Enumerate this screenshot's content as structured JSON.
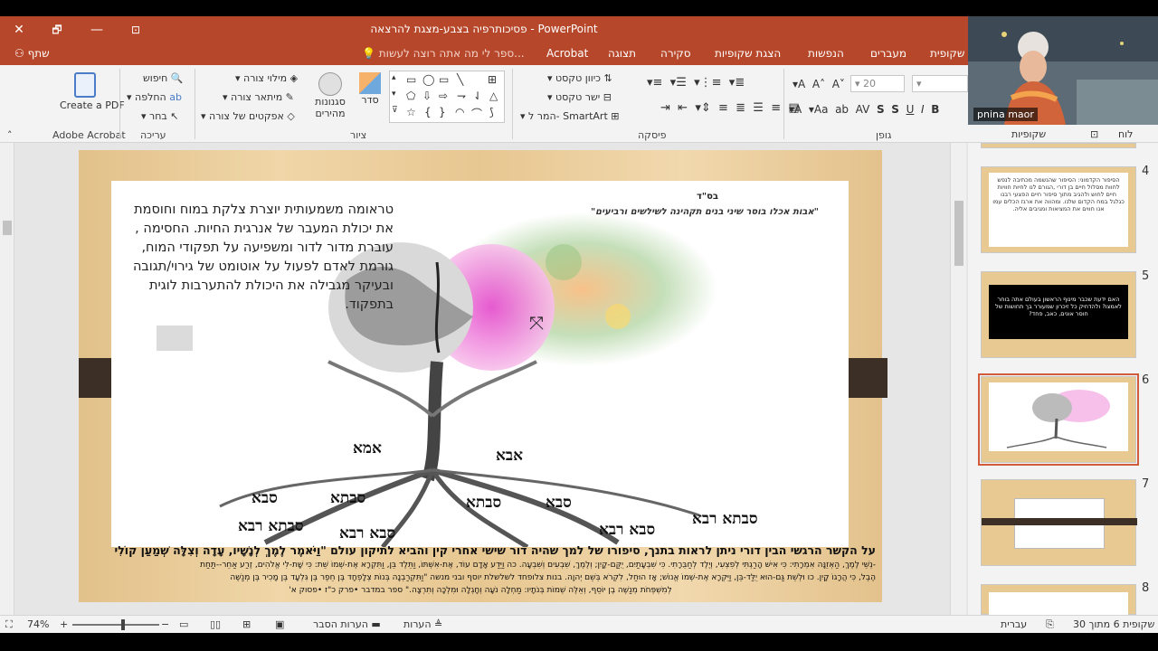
{
  "window": {
    "title": "פסיכותרפיה בצבע-מצגת להרצאה - PowerPoint",
    "close": "✕",
    "restore": "🗗",
    "minimize": "—",
    "ribbon_display": "⊡"
  },
  "tabs": {
    "items": [
      "שקופית",
      "מעברים",
      "הנפשות",
      "הצגת שקופיות",
      "סקירה",
      "תצוגה",
      "Acrobat"
    ],
    "tell_me": "ספר לי מה אתה רוצה לעשות...",
    "share": "שתף"
  },
  "ribbon": {
    "acrobat": {
      "create_pdf": "Create a PDF",
      "group": "Adobe Acrobat"
    },
    "editing": {
      "find": "חיפוש",
      "replace": "החלפה",
      "select": "בחר",
      "group": "עריכה"
    },
    "drawing": {
      "shape_fill": "מילוי צורה",
      "shape_outline": "מיתאר צורה",
      "shape_effects": "אפקטים של צורה",
      "quick_styles": "סגנונות מהירים",
      "arrange": "סדר",
      "group": "ציור",
      "shapes": [
        "▭",
        "◯",
        "▭",
        "╲",
        "⊞",
        "⬠",
        "⇩",
        "⇨",
        "⇁",
        "⇃",
        "△",
        "☆",
        "{",
        "}",
        "◠",
        "⌒",
        "⟆"
      ]
    },
    "paragraph": {
      "text_direction": "כיוון טקסט",
      "align_text": "ישר טקסט",
      "smartart": "המר ל- SmartArt",
      "group": "פיסקה"
    },
    "font": {
      "size": "20",
      "group": "גופן",
      "bold": "B",
      "italic": "I",
      "underline": "U",
      "strike": "S"
    },
    "slides_group": "לוח"
  },
  "panes": {
    "thumbnails_label": "שקופיות",
    "clipboard_label": "לוח"
  },
  "slide": {
    "bsd": "בס\"ד",
    "subtitle": "\"אבות אכלו בוסר שיני בנים תקהינה לשילשים ורביעים\"",
    "trauma_text": "טראומה משמעותית יוצרת צלקת  במוח וחוסמת את יכולת המעבר של אנרגית החיות. החסימה , עוברת מדור לדור ומשפיעה על תפקודי המוח, גורמת לאדם לפעול על אוטומט של גירוי/תגובה ובעיקר מגבילה את היכולת להתערבות לוגית בתפקוד.",
    "family": {
      "ima": "אמא",
      "aba": "אבא",
      "saba1": "סבא",
      "savta1": "סבתא",
      "savta2": "סבתא",
      "saba2": "סבא",
      "savta_raba1": "סבתא רבא",
      "saba_raba1": "סבא רבא",
      "saba_raba2": "סבא רבא",
      "savta_raba2": "סבתא רבא"
    },
    "bottom": {
      "line1": "על הקשר הרגשי הבין דורי ניתן לראות בתנך,  סיפורו של למך שהיה דור שישי אחרי קין  והביא לתיקון עולם \"וַיֹּאמֶר לֶמֶךְ לְנָשָׁיו, עָדָה וְצִלָּה שְׁמַעַן קוֹלִי",
      "line2": "-נְשֵׁי לֶמֶךְ, הַאְזֵנָּה אִמְרָתִי:  כִּי אִישׁ הָרַגְתִּי לְפִצְעִי, וְיֶלֶד לְחַבֻּרָתִי. כִּי שִׁבְעָתַיִם, יֻקַּם-קָיִן; וְלֶמֶךְ, שִׁבְעִים וְשִׁבְעָה. כה וַיֵּדַע אָדָם עוֹד, אֶת-אִשְׁתּוֹ, וַתֵּלֶד בֵּן, וַתִּקְרָא אֶת-שְׁמוֹ שֵׁת:  כִּי שָׁת-לִי אֱלֹהִים, זֶרַע אַחֵר--תַּחַת",
      "line3": "הֶבֶל, כִּי הֲרָגוֹ קָיִן.  כו וּלְשֵׁת גַּם-הוּא יֻלַּד-בֵּן, וַיִּקְרָא אֶת-שְׁמוֹ אֱנוֹשׁ; אָז הוּחַל, לִקְרֹא בְּשֵׁם יְהוָה.  בנות צלופחד  לשלשלת יוסף ובני מנשה \"וַתִּקְרַבְנָה בְּנוֹת צְלָפְחָד בֶּן חֵפֶר בֶּן גִּלְעָד בֶּן מָכִיר בֶּן מְנַשֶּׁה",
      "line4": "לְמִשְׁפְּחֹת מְנַשֶּׁה בֶן יוֹסֵף, וְאֵלֶּה שְׁמוֹת בְּנֹתָיו:  מַחְלָה נֹעָה וְחָגְלָה וּמִלְכָּה וְתִרְצָה.\" ספר במדבר  •פרק כ\"ז  •פסוק א'"
    }
  },
  "thumbnails": [
    {
      "num": "4",
      "text": "הסיפור הקדמוני: הסיפור שהנשמה מכתיבה לנפש לחוות מסלול חיים בן דורי ,הגורם לנו לחיות חוויות חיים לחוש ולהגיב מתוך סיפור חיים הפצעי רבנו כגלגל במח הקדום שלנו. ומהווה את ארגז הכלים עמו אנו חווים את המציאות ומגיבים אליה."
    },
    {
      "num": "5",
      "text": "האם ידעת שכבר מינוף הראשון בעולם אתה בוחר לאמצו? ולהדחיק כל זיכרון שמעורר בך תחושות של חוסר אונים, כאב, פחד?"
    },
    {
      "num": "6",
      "text": ""
    },
    {
      "num": "7",
      "text": ""
    },
    {
      "num": "8",
      "text": ""
    }
  ],
  "statusbar": {
    "slide_info": "שקופית 6 מתוך 30",
    "language": "עברית",
    "notes": "הערות",
    "comments": "הערות הסבר",
    "zoom": "74%"
  },
  "webcam": {
    "name": "pnina maor"
  },
  "colors": {
    "accent": "#b7472a",
    "selected_thumb": "#d05a3a"
  }
}
